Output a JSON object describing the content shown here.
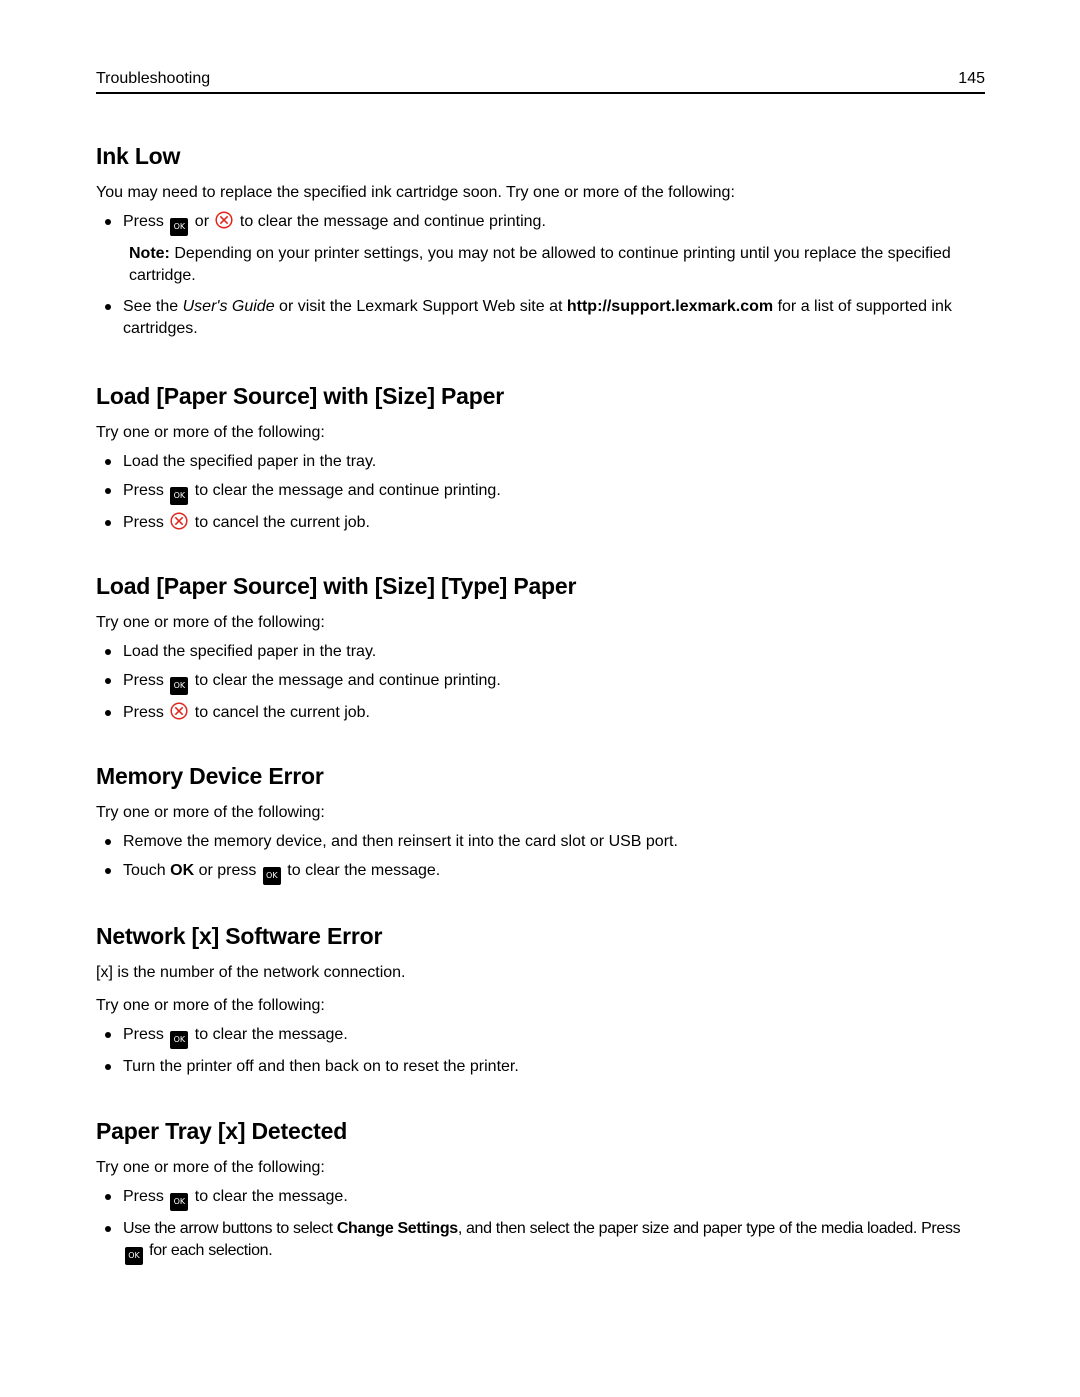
{
  "header": {
    "section": "Troubleshooting",
    "page_number": "145"
  },
  "colors": {
    "cancel_icon": "#e0261d",
    "ok_icon_bg": "#000000"
  },
  "icons": {
    "ok": "ok-button-icon",
    "cancel": "cancel-x-circle-icon",
    "ok_label": "OK"
  },
  "sections": [
    {
      "title": "Ink Low",
      "intro": "You may need to replace the specified ink cartridge soon. Try one or more of the following:",
      "b1_pre": "Press ",
      "b1_mid": " or ",
      "b1_post": " to clear the message and continue printing.",
      "note_label": "Note:",
      "note_text": " Depending on your printer settings, you may not be allowed to continue printing until you replace the specified cartridge.",
      "b2_pre": "See the ",
      "b2_italic": "User's Guide",
      "b2_mid": " or visit the Lexmark Support Web site at ",
      "b2_bold": "http://support.lexmark.com",
      "b2_post": " for a list of supported ink cartridges."
    },
    {
      "title": "Load [Paper Source] with [Size] Paper",
      "intro": "Try one or more of the following:",
      "b1": "Load the specified paper in the tray.",
      "b2_pre": "Press ",
      "b2_post": " to clear the message and continue printing.",
      "b3_pre": "Press ",
      "b3_post": " to cancel the current job."
    },
    {
      "title": "Load [Paper Source] with [Size] [Type] Paper",
      "intro": "Try one or more of the following:",
      "b1": "Load the specified paper in the tray.",
      "b2_pre": "Press ",
      "b2_post": " to clear the message and continue printing.",
      "b3_pre": "Press ",
      "b3_post": " to cancel the current job."
    },
    {
      "title": "Memory Device Error",
      "intro": "Try one or more of the following:",
      "b1": "Remove the memory device, and then reinsert it into the card slot or USB port.",
      "b2_pre": "Touch ",
      "b2_bold": "OK",
      "b2_mid": " or press ",
      "b2_post": " to clear the message."
    },
    {
      "title": "Network [x] Software Error",
      "desc": "[x] is the number of the network connection.",
      "intro": "Try one or more of the following:",
      "b1_pre": "Press ",
      "b1_post": " to clear the message.",
      "b2": "Turn the printer off and then back on to reset the printer."
    },
    {
      "title": "Paper Tray [x] Detected",
      "intro": "Try one or more of the following:",
      "b1_pre": "Press ",
      "b1_post": " to clear the message.",
      "b2_pre": "Use the arrow buttons to select ",
      "b2_bold": "Change Settings",
      "b2_mid": ", and then select the paper size and paper type of the media loaded. Press ",
      "b2_post": " for each selection."
    }
  ]
}
